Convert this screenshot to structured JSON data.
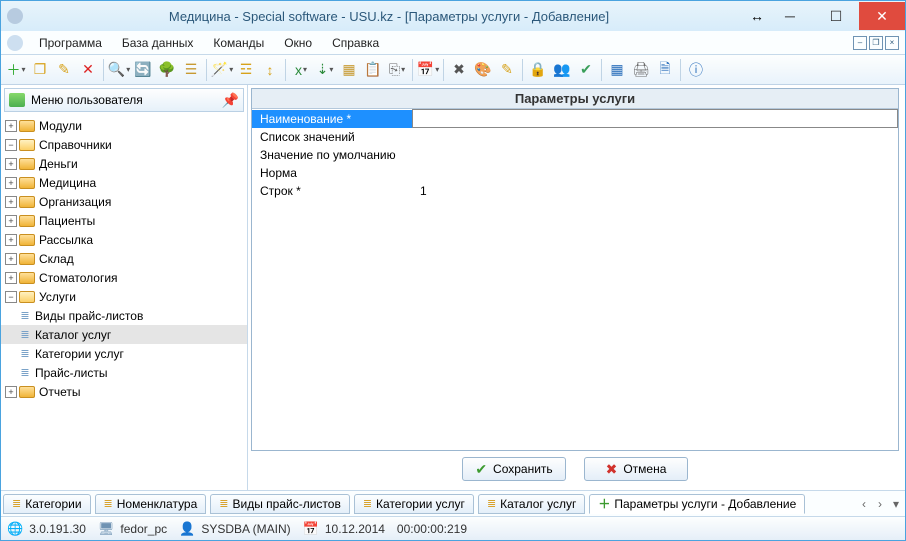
{
  "title": "Медицина - Special software - USU.kz - [Параметры услуги - Добавление]",
  "menu": [
    "Программа",
    "База данных",
    "Команды",
    "Окно",
    "Справка"
  ],
  "sidebar": {
    "title": "Меню пользователя",
    "n": {
      "modules": "Модули",
      "spravochniki": "Справочники",
      "dengi": "Деньги",
      "meditsina": "Медицина",
      "organizatsiya": "Организация",
      "patsienty": "Пациенты",
      "rassylka": "Рассылка",
      "sklad": "Склад",
      "stomatologiya": "Стоматология",
      "uslugi": "Услуги",
      "vidy_price": "Виды прайс-листов",
      "katalog_uslug": "Каталог услуг",
      "kategorii_uslug": "Категории услуг",
      "price_listy": "Прайс-листы",
      "otchety": "Отчеты"
    }
  },
  "form": {
    "title": "Параметры услуги",
    "rows": {
      "name_lbl": "Наименование *",
      "name_val": "",
      "list_lbl": "Список значений",
      "list_val": "",
      "def_lbl": "Значение по умолчанию",
      "def_val": "",
      "norm_lbl": "Норма",
      "norm_val": "",
      "rows_lbl": "Строк *",
      "rows_val": "1"
    },
    "save": "Сохранить",
    "cancel": "Отмена"
  },
  "tabs": {
    "t1": "Категории",
    "t2": "Номенклатура",
    "t3": "Виды прайс-листов",
    "t4": "Категории услуг",
    "t5": "Каталог услуг",
    "t6": "Параметры услуги - Добавление"
  },
  "status": {
    "ver": "3.0.191.30",
    "pc": "fedor_pc",
    "user": "SYSDBA (MAIN)",
    "date": "10.12.2014",
    "time": "00:00:00:219"
  }
}
